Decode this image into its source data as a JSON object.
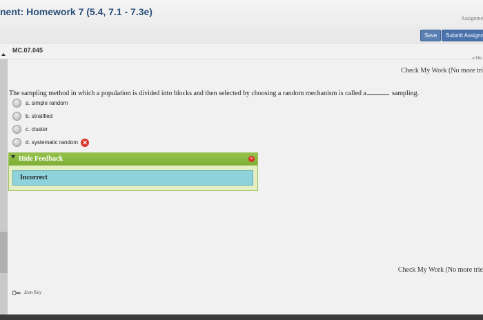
{
  "header": {
    "title": "nent: Homework 7 (5.4, 7.1 - 7.3e)",
    "assign_label": "Assignme"
  },
  "toolbar": {
    "save_label": "Save",
    "submit_label": "Submit Assignm"
  },
  "question_bar": {
    "id": "MC.07.045",
    "nav_label": "« Qu"
  },
  "check_work": {
    "top": "Check My Work (No more tri",
    "bottom": "Check My Work (No more trie"
  },
  "question": {
    "text_before": "The sampling method in which a population is divided into blocks and then selected by choosing a random mechanism is called a",
    "text_after": "sampling.",
    "choices": [
      {
        "label": "a. simple random"
      },
      {
        "label": "b. stratified"
      },
      {
        "label": "c. cluster"
      },
      {
        "label": "d. systematic random",
        "selected": true,
        "marked": "incorrect"
      }
    ]
  },
  "feedback": {
    "toggle_label": "Hide Feedback",
    "result": "Incorrect"
  },
  "footer": {
    "icon_key_label": "Icon Key"
  },
  "colors": {
    "title": "#2a4f7a",
    "feedback_header": "#8bbb43",
    "incorrect_bg": "#8ed2dc",
    "error_red": "#d9342b"
  }
}
